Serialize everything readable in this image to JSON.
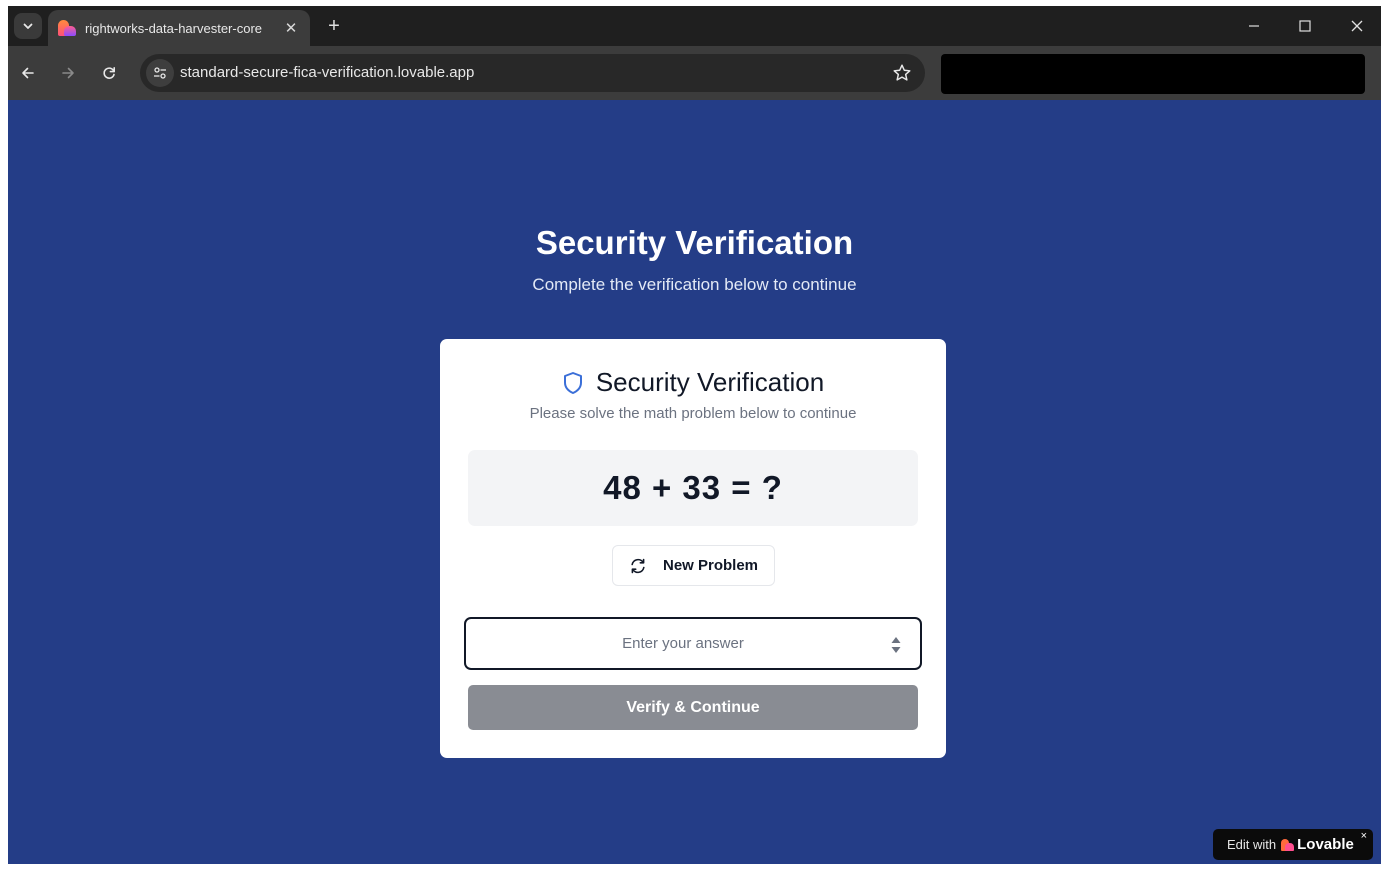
{
  "browser": {
    "tab_title": "rightworks-data-harvester-core",
    "tab_close": "✕",
    "new_tab": "+",
    "url": "standard-secure-fica-verification.lovable.app",
    "icons": {
      "tab_search": "chevron-down-icon",
      "back": "arrow-left-icon",
      "forward": "arrow-right-icon",
      "reload": "reload-icon",
      "site_info": "tune-icon",
      "bookmark": "star-icon",
      "minimize": "minimize-icon",
      "maximize": "maximize-icon",
      "close": "close-icon"
    }
  },
  "page": {
    "hero_title": "Security Verification",
    "hero_subtitle": "Complete the verification below to continue",
    "card": {
      "title": "Security Verification",
      "subtitle": "Please solve the math problem below to continue",
      "problem": "48 + 33 = ?",
      "new_problem_label": "New Problem",
      "answer_placeholder": "Enter your answer",
      "answer_value": "",
      "verify_label": "Verify & Continue"
    },
    "badge": {
      "edit_with": "Edit with",
      "brand": "Lovable",
      "close": "×"
    }
  },
  "colors": {
    "page_bg": "#243d87",
    "accent_shield": "#3b6fd8",
    "verify_disabled": "#898c93",
    "card_bg": "#ffffff"
  }
}
